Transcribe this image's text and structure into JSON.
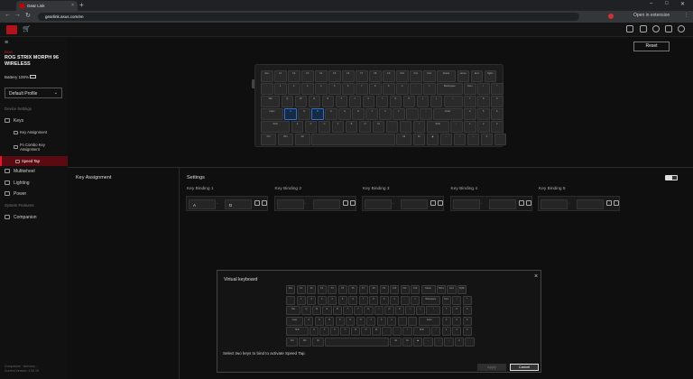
{
  "browser": {
    "tab_title": "Gear Link",
    "url": "gearlink.asus.com/en",
    "right_label": "Open in extension"
  },
  "sidebar": {
    "brand": "ROG",
    "device_name": "ROG STRIX MORPH 96 WIRELESS",
    "battery": "Battery 100%",
    "profile": "Default Profile",
    "device_settings": "Device Settings",
    "keys": "Keys",
    "key_assignment": "Key Assignment",
    "fn_combo": "Fn Combo Key Assignment",
    "speed_tap": "Speed Tap",
    "multiwheel": "Multiwheel",
    "lighting": "Lighting",
    "power": "Power",
    "system_features": "System Features",
    "companion": "Companion",
    "footer_1": "Companion · Armoury...",
    "footer_2": "Current Version: 1.00.15"
  },
  "main": {
    "reset": "Reset",
    "key_assignment": "Key Assignment",
    "settings": "Settings",
    "toggle": "ON",
    "bindings": [
      {
        "label": "Key Binding 1",
        "key1": "A",
        "key2": "D"
      },
      {
        "label": "Key Binding 2",
        "key1": "",
        "key2": ""
      },
      {
        "label": "Key Binding 3",
        "key1": "",
        "key2": ""
      },
      {
        "label": "Key Binding 4",
        "key1": "",
        "key2": ""
      },
      {
        "label": "Key Binding 5",
        "key1": "",
        "key2": ""
      }
    ]
  },
  "modal": {
    "title": "Virtual keyboard",
    "hint": "Select two keys to bind to activate Speed Tap.",
    "apply": "Apply",
    "cancel": "Cancel"
  },
  "keyboard": {
    "rows": [
      [
        "Esc",
        "F1",
        "F2",
        "F3",
        "F4",
        "F5",
        "F6",
        "F7",
        "F8",
        "F9",
        "F10",
        "F11",
        "F12",
        "Delete",
        "Home",
        "End",
        "PgDn"
      ],
      [
        "`",
        "1",
        "2",
        "3",
        "4",
        "5",
        "6",
        "7",
        "8",
        "9",
        "0",
        "-",
        "=",
        "Backspace",
        "Num",
        "/",
        "*"
      ],
      [
        "Tab",
        "Q",
        "W",
        "E",
        "R",
        "T",
        "Y",
        "U",
        "I",
        "O",
        "P",
        "[",
        "]",
        "\\",
        "7",
        "8",
        "9"
      ],
      [
        "Caps",
        "A",
        "S",
        "D",
        "F",
        "G",
        "H",
        "J",
        "K",
        "L",
        ";",
        "'",
        "Enter",
        "4",
        "5",
        "6"
      ],
      [
        "Shift",
        "Z",
        "X",
        "C",
        "V",
        "B",
        "N",
        "M",
        ",",
        ".",
        "/",
        "Shift",
        "↑",
        "1",
        "2",
        "3"
      ],
      [
        "Ctrl",
        "Win",
        "Alt",
        "",
        "Alt",
        "Fn",
        "◉",
        "←",
        "↓",
        "→",
        "0",
        "."
      ]
    ],
    "highlight": [
      "A",
      "D"
    ]
  }
}
